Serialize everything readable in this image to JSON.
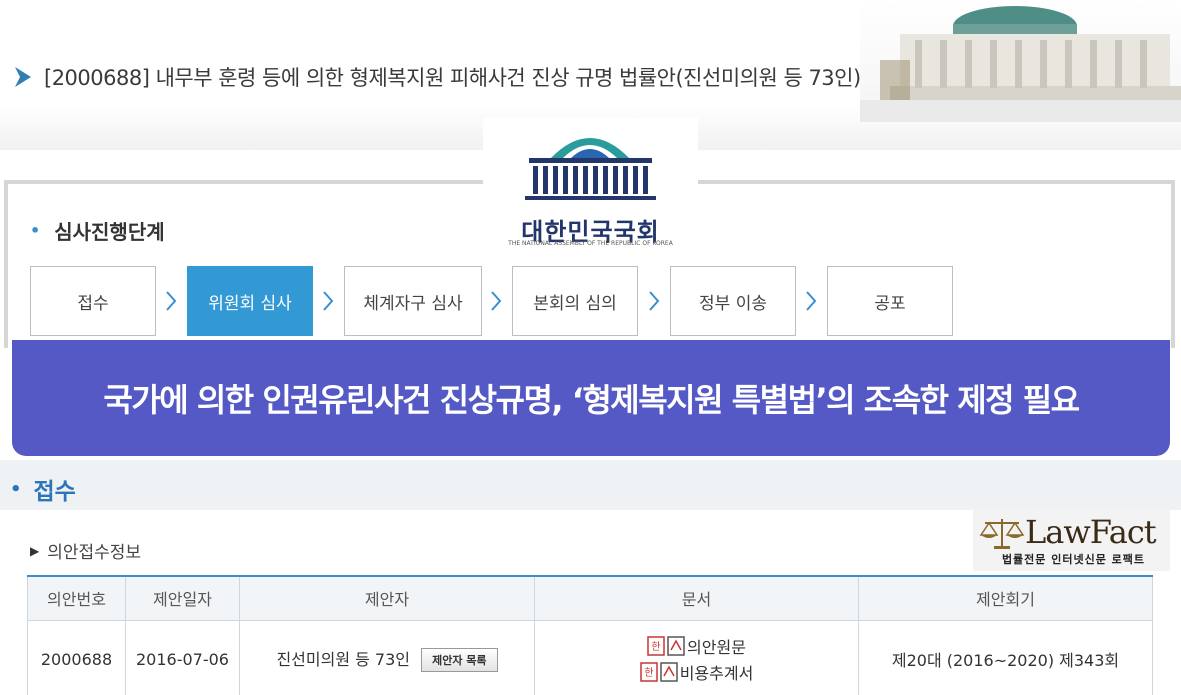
{
  "header": {
    "bill_title": "[2000688] 내무부 훈령 등에 의한 형제복지원 피해사건 진상 규명 법률안(진선미의원 등 73인)"
  },
  "logo": {
    "name": "대한민국국회",
    "subtitle": "THE NATIONAL ASSEMBLY OF THE REPUBLIC OF KOREA"
  },
  "progress": {
    "heading": "심사진행단계",
    "steps": [
      {
        "label": "접수",
        "active": false
      },
      {
        "label": "위원회 심사",
        "active": true
      },
      {
        "label": "체계자구 심사",
        "active": false
      },
      {
        "label": "본회의 심의",
        "active": false
      },
      {
        "label": "정부 이송",
        "active": false
      },
      {
        "label": "공포",
        "active": false
      }
    ]
  },
  "banner": {
    "headline": "국가에 의한 인권유린사건 진상규명, ‘형제복지원 특별법’의 조속한 제정 필요"
  },
  "reception": {
    "section_label": "접수",
    "info_heading": "의안접수정보",
    "columns": [
      "의안번호",
      "제안일자",
      "제안자",
      "문서",
      "제안회기"
    ],
    "row": {
      "bill_no": "2000688",
      "date": "2016-07-06",
      "proposer": "진선미의원 등 73인",
      "proposer_button": "제안자 목록",
      "documents": [
        "의안원문",
        "비용추계서"
      ],
      "session": "제20대 (2016~2020) 제343회"
    }
  },
  "watermark": {
    "brand": "LawFact",
    "tagline": "법률전문 인터넷신문 로팩트"
  },
  "colors": {
    "accent_blue": "#3399d4",
    "banner": "#5459c5",
    "section_title": "#2d74b8"
  }
}
